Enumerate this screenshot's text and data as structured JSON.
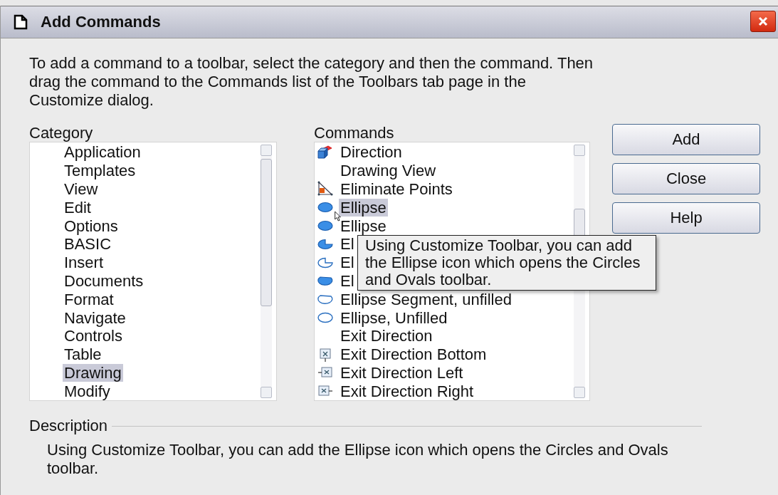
{
  "window": {
    "title": "Add Commands"
  },
  "intro": "To add a command to a toolbar, select the category and then the command. Then drag the command to the Commands list of the Toolbars tab page in the Customize dialog.",
  "category": {
    "label": "Category",
    "items": [
      {
        "label": "Application",
        "selected": false
      },
      {
        "label": "Templates",
        "selected": false
      },
      {
        "label": "View",
        "selected": false
      },
      {
        "label": "Edit",
        "selected": false
      },
      {
        "label": "Options",
        "selected": false
      },
      {
        "label": "BASIC",
        "selected": false
      },
      {
        "label": "Insert",
        "selected": false
      },
      {
        "label": "Documents",
        "selected": false
      },
      {
        "label": "Format",
        "selected": false
      },
      {
        "label": "Navigate",
        "selected": false
      },
      {
        "label": "Controls",
        "selected": false
      },
      {
        "label": "Table",
        "selected": false
      },
      {
        "label": "Drawing",
        "selected": true
      },
      {
        "label": "Modify",
        "selected": false
      }
    ]
  },
  "commands": {
    "label": "Commands",
    "items": [
      {
        "label": "Direction",
        "kind": "direction",
        "selected": false
      },
      {
        "label": "Drawing View",
        "kind": "plain",
        "selected": false
      },
      {
        "label": "Eliminate Points",
        "kind": "eliminate",
        "selected": false
      },
      {
        "label": "Ellipse",
        "kind": "ellipse",
        "selected": true
      },
      {
        "label": "Ellipse",
        "kind": "ellipse",
        "selected": false
      },
      {
        "label": "El",
        "kind": "pie",
        "selected": false
      },
      {
        "label": "El",
        "kind": "arc",
        "selected": false
      },
      {
        "label": "El",
        "kind": "segment",
        "selected": false
      },
      {
        "label": "Ellipse Segment, unfilled",
        "kind": "segment-unfilled",
        "selected": false
      },
      {
        "label": "Ellipse, Unfilled",
        "kind": "ellipse-unfilled",
        "selected": false
      },
      {
        "label": "Exit Direction",
        "kind": "plain",
        "selected": false
      },
      {
        "label": "Exit Direction Bottom",
        "kind": "exit-bottom",
        "selected": false
      },
      {
        "label": "Exit Direction Left",
        "kind": "exit-left",
        "selected": false
      },
      {
        "label": "Exit Direction Right",
        "kind": "exit-right",
        "selected": false
      }
    ],
    "tooltip": "Using Customize Toolbar, you can add the Ellipse icon which opens the Circles and Ovals toolbar."
  },
  "buttons": [
    {
      "label": "Add"
    },
    {
      "label": "Close"
    },
    {
      "label": "Help"
    }
  ],
  "description": {
    "label": "Description",
    "text": "Using Customize Toolbar, you can add the Ellipse icon which opens the Circles and Ovals toolbar."
  }
}
